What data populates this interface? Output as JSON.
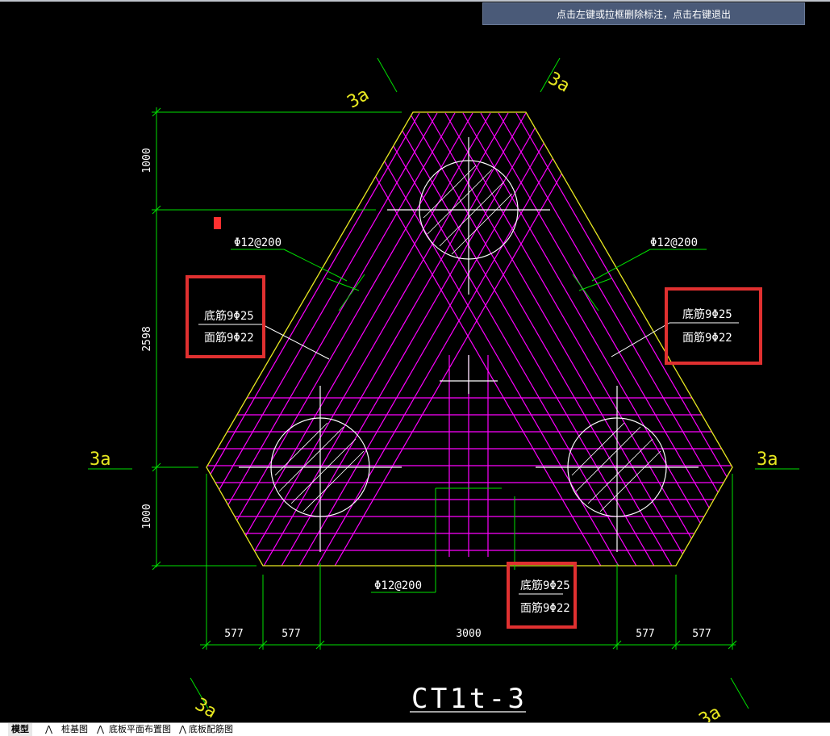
{
  "status_bar": {
    "message": "点击左键或拉框删除标注，点击右键退出"
  },
  "drawing": {
    "title": "CT1t-3",
    "axis_label": "3a",
    "rebar_spacing_label": "Φ12@200",
    "bottom_rebar": "底筋9Φ25",
    "top_rebar": "面筋9Φ22",
    "dims_vertical": [
      "1000",
      "2598",
      "1000"
    ],
    "dims_horizontal": [
      "577",
      "577",
      "3000",
      "577",
      "577"
    ]
  },
  "tabs": [
    {
      "label": "模型",
      "active": true
    },
    {
      "label": "桩基图",
      "active": false
    },
    {
      "label": "底板平面布置图",
      "active": false
    },
    {
      "label": "底板配筋图",
      "active": false
    }
  ],
  "colors": {
    "outline": "#e8e820",
    "rebar": "#ff00ff",
    "dimension": "#00e000",
    "annotation": "#ffffff",
    "highlight": "#e03030",
    "axis_text": "#e8e820"
  }
}
